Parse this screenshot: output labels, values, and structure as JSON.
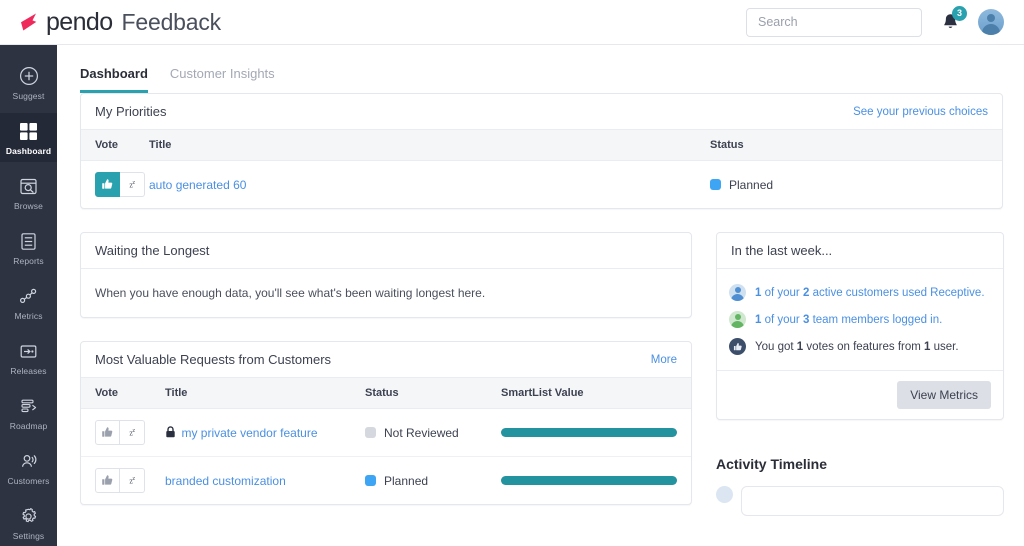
{
  "brand": {
    "logo_icon": "pendo-logo-icon",
    "name": "pendo",
    "product": "Feedback"
  },
  "topbar": {
    "search": {
      "placeholder": "Search",
      "value": "",
      "icon": "search-icon"
    },
    "notifications": {
      "icon": "bell-icon",
      "count": "3"
    },
    "avatar": {
      "icon": "user-avatar-icon"
    }
  },
  "sidebar": {
    "items": [
      {
        "label": "Suggest",
        "icon": "plus-circle-icon",
        "active": false
      },
      {
        "label": "Dashboard",
        "icon": "grid-icon",
        "active": true
      },
      {
        "label": "Browse",
        "icon": "browse-search-icon",
        "active": false
      },
      {
        "label": "Reports",
        "icon": "report-list-icon",
        "active": false
      },
      {
        "label": "Metrics",
        "icon": "metrics-graph-icon",
        "active": false
      },
      {
        "label": "Releases",
        "icon": "releases-arrow-icon",
        "active": false
      },
      {
        "label": "Roadmap",
        "icon": "roadmap-icon",
        "active": false
      },
      {
        "label": "Customers",
        "icon": "customers-icon",
        "active": false
      }
    ],
    "bottom": {
      "label": "Settings",
      "icon": "gear-icon"
    }
  },
  "tabs": [
    {
      "label": "Dashboard",
      "active": true
    },
    {
      "label": "Customer Insights",
      "active": false
    }
  ],
  "my_priorities": {
    "title": "My Priorities",
    "link": "See your previous choices",
    "columns": {
      "vote": "Vote",
      "title": "Title",
      "status": "Status"
    },
    "rows": [
      {
        "vote": {
          "up_icon": "thumbs-up-icon",
          "up_active": true,
          "snooze_icon": "snooze-icon"
        },
        "title": "auto generated 60",
        "private": false,
        "status": "Planned",
        "status_color": "#3da5f4"
      }
    ]
  },
  "waiting_longest": {
    "title": "Waiting the Longest",
    "empty_message": "When you have enough data, you'll see what's been waiting longest here."
  },
  "most_valuable": {
    "title": "Most Valuable Requests from Customers",
    "link": "More",
    "columns": {
      "vote": "Vote",
      "title": "Title",
      "status": "Status",
      "smartlist": "SmartList Value"
    },
    "rows": [
      {
        "vote": {
          "up_icon": "thumbs-up-icon",
          "up_active": false,
          "snooze_icon": "snooze-icon"
        },
        "title": "my private vendor feature",
        "private": true,
        "lock_icon": "lock-icon",
        "status": "Not Reviewed",
        "status_color": "#d5d8de",
        "smartlist_pct": 100
      },
      {
        "vote": {
          "up_icon": "thumbs-up-icon",
          "up_active": false,
          "snooze_icon": "snooze-icon"
        },
        "title": "branded customization",
        "private": false,
        "status": "Planned",
        "status_color": "#3da5f4",
        "smartlist_pct": 100
      }
    ]
  },
  "last_week": {
    "title": "In the last week...",
    "items": [
      {
        "icon": "blue-user-avatar-icon",
        "parts": [
          {
            "text": "1",
            "bold": true,
            "link": true
          },
          {
            "text": " of your ",
            "bold": false,
            "link": true
          },
          {
            "text": "2",
            "bold": true,
            "link": true
          },
          {
            "text": " active customers used Receptive.",
            "bold": false,
            "link": true
          }
        ]
      },
      {
        "icon": "green-user-avatar-icon",
        "parts": [
          {
            "text": "1",
            "bold": true,
            "link": true
          },
          {
            "text": " of your ",
            "bold": false,
            "link": true
          },
          {
            "text": "3",
            "bold": true,
            "link": true
          },
          {
            "text": " team members logged in.",
            "bold": false,
            "link": true
          }
        ]
      },
      {
        "icon": "thumbs-up-circle-icon",
        "parts": [
          {
            "text": "You got ",
            "bold": false,
            "link": false
          },
          {
            "text": "1",
            "bold": true,
            "link": false
          },
          {
            "text": " votes on features from ",
            "bold": false,
            "link": false
          },
          {
            "text": "1",
            "bold": true,
            "link": false
          },
          {
            "text": " user.",
            "bold": false,
            "link": false
          }
        ]
      }
    ],
    "button": "View Metrics"
  },
  "activity_timeline": {
    "title": "Activity Timeline"
  },
  "colors": {
    "accent_teal": "#2aa1ae",
    "link_blue": "#4a90e2",
    "sidebar_bg": "#2e3342",
    "brand_pink": "#ee2a5c",
    "smartlist_bar": "#23939f"
  }
}
